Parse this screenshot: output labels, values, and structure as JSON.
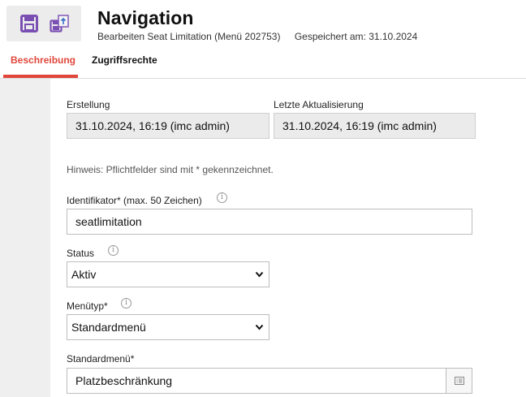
{
  "header": {
    "title": "Navigation",
    "subtitle": "Bearbeiten Seat Limitation (Menü 202753)",
    "saved_at": "Gespeichert am: 31.10.2024"
  },
  "toolbar": {
    "save_icon": "save-disk-icon",
    "publish_icon": "save-publish-icon",
    "icon_color": "#7a4fb3"
  },
  "tabs": [
    {
      "label": "Beschreibung",
      "active": true
    },
    {
      "label": "Zugriffsrechte",
      "active": false
    }
  ],
  "accent_color": "#e0463a",
  "form": {
    "created_label": "Erstellung",
    "created_value": "31.10.2024, 16:19 (imc admin)",
    "updated_label": "Letzte Aktualisierung",
    "updated_value": "31.10.2024, 16:19 (imc admin)",
    "hint": "Hinweis: Pflichtfelder sind mit * gekennzeichnet.",
    "identifier_label": "Identifikator* (max. 50 Zeichen)",
    "identifier_value": "seatlimitation",
    "status_label": "Status",
    "status_value": "Aktiv",
    "menutype_label": "Menütyp*",
    "menutype_value": "Standardmenü",
    "standardmenu_label": "Standardmenü*",
    "standardmenu_value": "Platzbeschränkung",
    "info_glyph": "i"
  }
}
